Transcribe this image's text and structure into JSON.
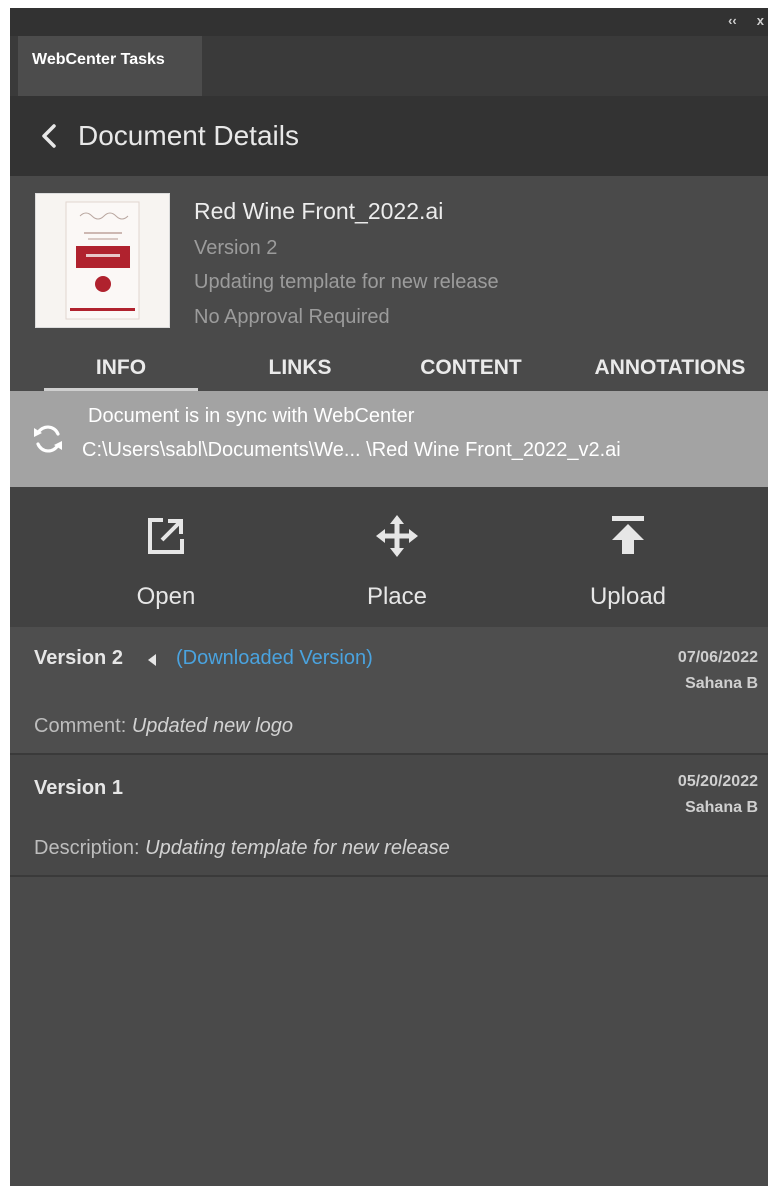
{
  "panel": {
    "tab_label": "WebCenter Tasks",
    "controls": {
      "collapse": "‹‹",
      "close": "x"
    }
  },
  "header": {
    "title": "Document Details"
  },
  "document": {
    "name": "Red Wine Front_2022.ai",
    "version": "Version 2",
    "description": "Updating template for new release",
    "approval": "No Approval Required"
  },
  "tabs": [
    {
      "label": "INFO",
      "active": true
    },
    {
      "label": "LINKS",
      "active": false
    },
    {
      "label": "CONTENT",
      "active": false
    },
    {
      "label": "ANNOTATIONS",
      "active": false
    }
  ],
  "sync": {
    "status": "Document is in sync with WebCenter",
    "path": "C:\\Users\\sabl\\Documents\\We...  \\Red Wine Front_2022_v2.ai"
  },
  "actions": {
    "open": "Open",
    "place": "Place",
    "upload": "Upload"
  },
  "versions": [
    {
      "name": "Version 2",
      "tag": "(Downloaded Version)",
      "date": "07/06/2022",
      "author": "Sahana B",
      "note_label": "Comment:",
      "note_value": "Updated new logo"
    },
    {
      "name": "Version 1",
      "date": "05/20/2022",
      "author": "Sahana B",
      "note_label": "Description:",
      "note_value": "Updating template for new release"
    }
  ],
  "colors": {
    "panel_bg": "#4a4a4a",
    "header_bg": "#333333",
    "sync_bg": "#a3a3a3",
    "link_accent": "#4aa3df"
  }
}
